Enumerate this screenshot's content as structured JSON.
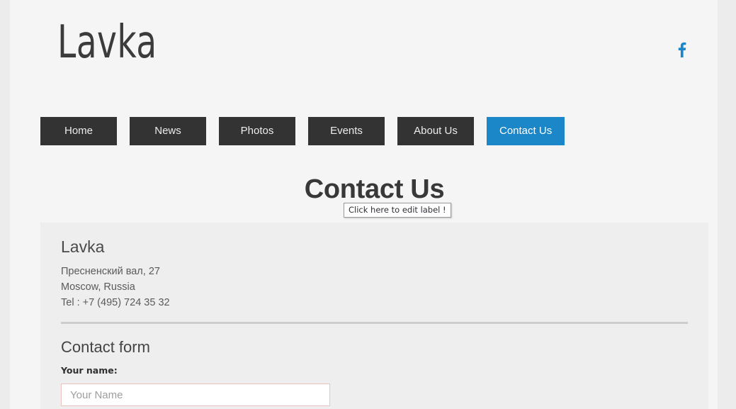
{
  "site": {
    "brand": "Lavka",
    "social": [
      {
        "name": "facebook-icon",
        "label": "f",
        "color": "#1b86c8"
      }
    ]
  },
  "nav": {
    "items": [
      {
        "label": "Home",
        "active": false
      },
      {
        "label": "News",
        "active": false
      },
      {
        "label": "Photos",
        "active": false
      },
      {
        "label": "Events",
        "active": false
      },
      {
        "label": "About Us",
        "active": false
      },
      {
        "label": "Contact Us",
        "active": true
      }
    ]
  },
  "page": {
    "title": "Contact Us",
    "edit_tooltip": "Click here to edit label !"
  },
  "contact": {
    "org_name": "Lavka",
    "address_line_1": "Пресненский вал, 27",
    "address_line_2": "Moscow, Russia",
    "phone_line": "Tel : +7 (495) 724 35 32"
  },
  "form": {
    "heading": "Contact form",
    "name_label": "Your name:",
    "name_value": "",
    "name_placeholder": "Your Name"
  },
  "colors": {
    "nav_background": "#333333",
    "nav_active": "#1b86c8",
    "page_background": "#f5f5f6",
    "gutter": "#ececed",
    "panel": "#eeeeee",
    "input_border": "#e9c5bd",
    "divider": "#cccccc"
  }
}
